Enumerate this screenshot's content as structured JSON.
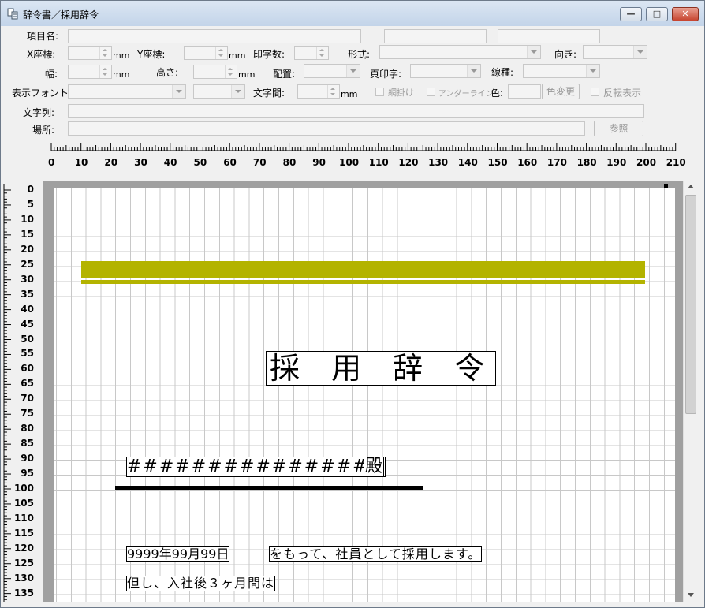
{
  "window": {
    "title": "辞令書／採用辞令",
    "min_label": "—",
    "max_label": "□",
    "close_label": "✕"
  },
  "props": {
    "item_name_label": "項目名:",
    "range_sep": "–",
    "x_label": "X座標:",
    "y_label": "Y座標:",
    "unit_mm": "mm",
    "digits_label": "印字数:",
    "format_label": "形式:",
    "direction_label": "向き:",
    "width_label": "幅:",
    "height_label": "高さ:",
    "align_label": "配置:",
    "page_print_label": "頁印字:",
    "linetype_label": "線種:",
    "font_label": "表示フォント:",
    "spacing_label": "文字間:",
    "hatch_label": "網掛け",
    "underline_label": "アンダーライン",
    "color_label": "色:",
    "color_change_button": "色変更",
    "invert_label": "反転表示",
    "string_label": "文字列:",
    "place_label": "場所:",
    "browse_button": "参照"
  },
  "ruler": {
    "h_labels": [
      "0",
      "10",
      "20",
      "30",
      "40",
      "50",
      "60",
      "70",
      "80",
      "90",
      "100",
      "110",
      "120",
      "130",
      "140",
      "150",
      "160",
      "170",
      "180",
      "190",
      "200",
      "210"
    ],
    "v_labels": [
      "0",
      "5",
      "10",
      "15",
      "20",
      "25",
      "30",
      "35",
      "40",
      "45",
      "50",
      "55",
      "60",
      "65",
      "70",
      "75",
      "80",
      "85",
      "90",
      "95",
      "100",
      "105",
      "110",
      "115",
      "120",
      "125",
      "130",
      "135"
    ]
  },
  "document": {
    "heading": "採 用 辞 令",
    "name_placeholder": "################",
    "honorific": "殿",
    "date": "9999年99月99日",
    "sentence": "をもって、社員として採用します。",
    "line3": "但し、入社後３ヶ月間は"
  },
  "colors": {
    "band": "#b3b300"
  }
}
